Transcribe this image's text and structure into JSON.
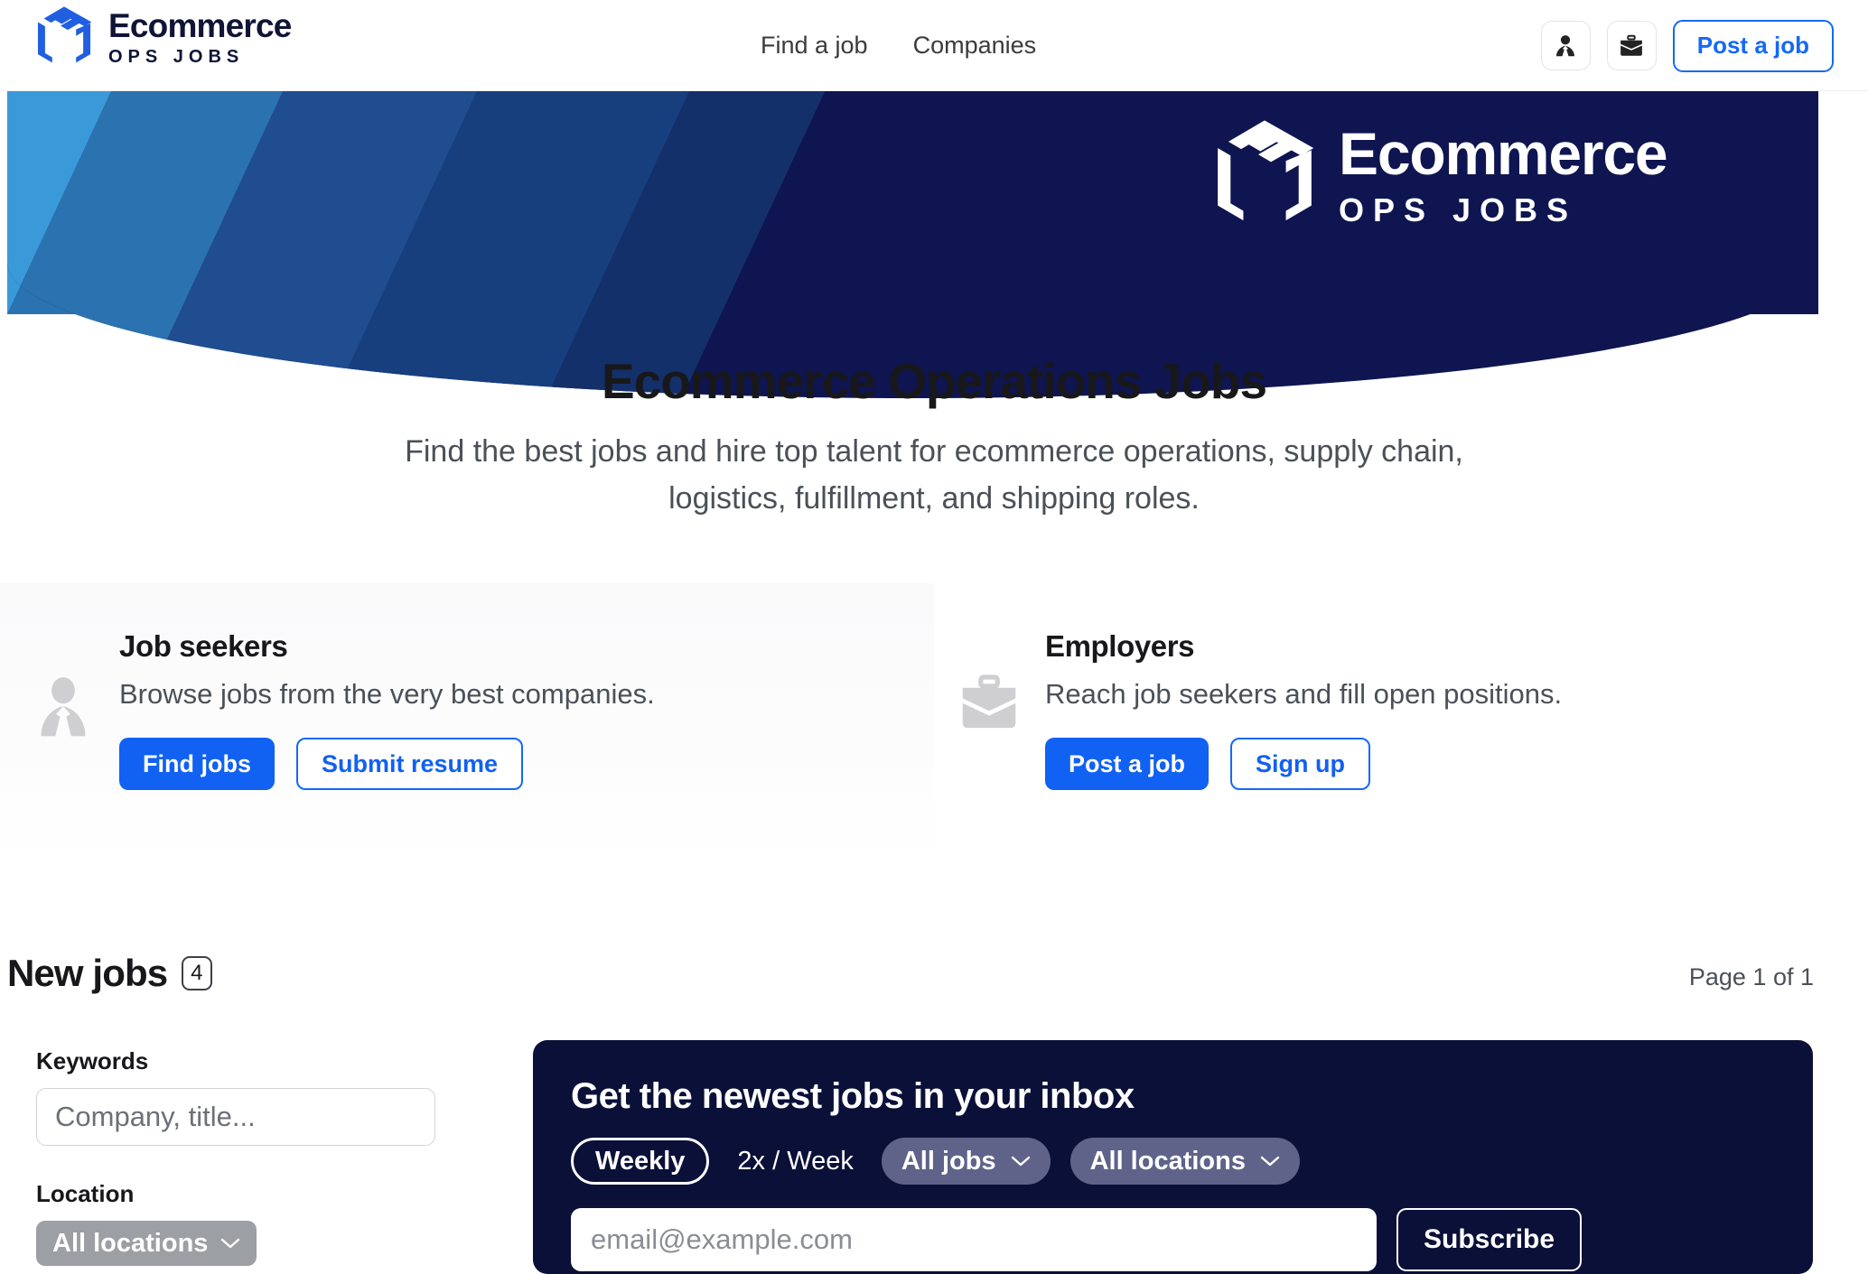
{
  "header": {
    "brand": {
      "title": "Ecommerce",
      "subtitle": "OPS JOBS"
    },
    "nav": [
      {
        "label": "Find a job"
      },
      {
        "label": "Companies"
      }
    ],
    "profile_icon": "person-icon",
    "briefcase_icon": "briefcase-icon",
    "post_job_label": "Post a job"
  },
  "hero": {
    "banner_brand_title": "Ecommerce",
    "banner_brand_subtitle": "OPS JOBS",
    "title": "Ecommerce Operations Jobs",
    "subtitle": "Find the best jobs and hire top talent for ecommerce operations, supply chain, logistics, fulfillment, and shipping roles."
  },
  "audience": {
    "seekers": {
      "heading": "Job seekers",
      "description": "Browse jobs from the very best companies.",
      "primary_label": "Find jobs",
      "secondary_label": "Submit resume",
      "icon": "person-icon"
    },
    "employers": {
      "heading": "Employers",
      "description": "Reach job seekers and fill open positions.",
      "primary_label": "Post a job",
      "secondary_label": "Sign up",
      "icon": "briefcase-icon"
    }
  },
  "jobs": {
    "heading": "New jobs",
    "count": "4",
    "page_indicator": "Page 1 of 1"
  },
  "filters": {
    "keywords_label": "Keywords",
    "keywords_value": "",
    "keywords_placeholder": "Company, title...",
    "location_label": "Location",
    "location_value": "All locations"
  },
  "newsletter": {
    "title": "Get the newest jobs in your inbox",
    "frequency_selected": "Weekly",
    "frequency_alt": "2x / Week",
    "jobs_filter": "All jobs",
    "locations_filter": "All locations",
    "email_value": "",
    "email_placeholder": "email@example.com",
    "subscribe_label": "Subscribe"
  },
  "colors": {
    "brand_blue": "#1161f2",
    "navy": "#0b1038",
    "banner_navy": "#0e1550",
    "pill_gray": "#9c9fa4",
    "nl_pill": "#5f6389"
  }
}
